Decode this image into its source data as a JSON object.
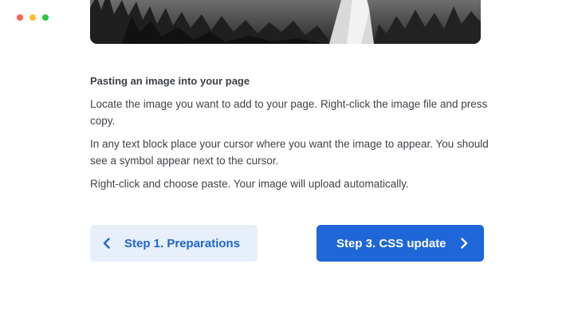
{
  "window": {
    "controls": [
      "close",
      "minimize",
      "maximize"
    ]
  },
  "hero_image": {
    "description_icon": "forest-landscape-image"
  },
  "article": {
    "heading": "Pasting an image into your page",
    "paragraphs": [
      "Locate the image you want to add to your page. Right-click the image file and press copy.",
      "In any text block place your cursor where you want the image to appear. You should see a symbol appear next to the cursor.",
      "Right-click and choose paste. Your image will upload automatically."
    ]
  },
  "navigation": {
    "prev_label": "Step 1. Preparations",
    "prev_icon": "chevron-left-icon",
    "next_label": "Step 3. CSS update",
    "next_icon": "chevron-right-icon"
  },
  "colors": {
    "accent": "#1f66d9",
    "accent_light": "#e6effa"
  }
}
